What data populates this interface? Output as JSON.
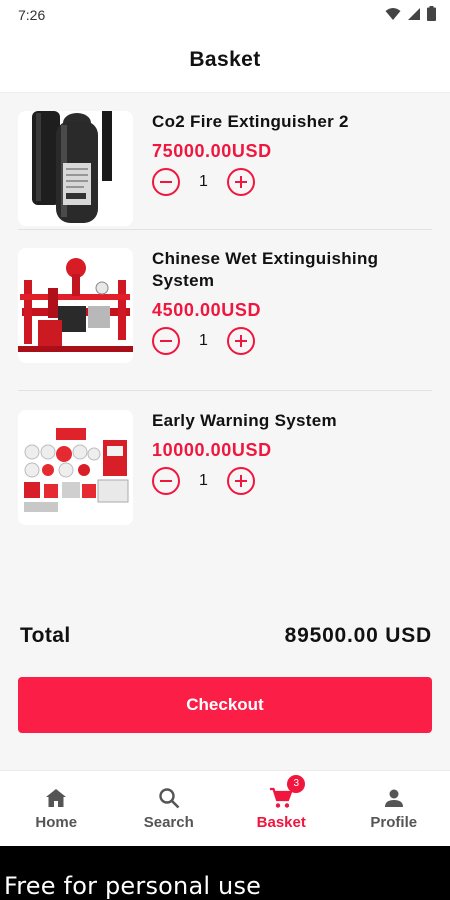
{
  "status_bar": {
    "time": "7:26"
  },
  "header": {
    "title": "Basket"
  },
  "items": [
    {
      "name": "Co2 Fire Extinguisher 2",
      "price": "75000.00USD",
      "quantity": "1"
    },
    {
      "name": "Chinese Wet Extinguishing System",
      "price": "4500.00USD",
      "quantity": "1"
    },
    {
      "name": "Early Warning System",
      "price": "10000.00USD",
      "quantity": "1"
    }
  ],
  "total": {
    "label": "Total",
    "value": "89500.00 USD"
  },
  "checkout": {
    "label": "Checkout"
  },
  "nav": {
    "items": [
      {
        "label": "Home",
        "icon": "home-icon",
        "active": false
      },
      {
        "label": "Search",
        "icon": "search-icon",
        "active": false
      },
      {
        "label": "Basket",
        "icon": "cart-icon",
        "active": true,
        "badge": "3"
      },
      {
        "label": "Profile",
        "icon": "person-icon",
        "active": false
      }
    ]
  },
  "watermark": {
    "text": "Free for personal use"
  },
  "colors": {
    "accent": "#f0163e",
    "checkout_bg": "#fb1f48",
    "background": "#f6f6f6"
  }
}
